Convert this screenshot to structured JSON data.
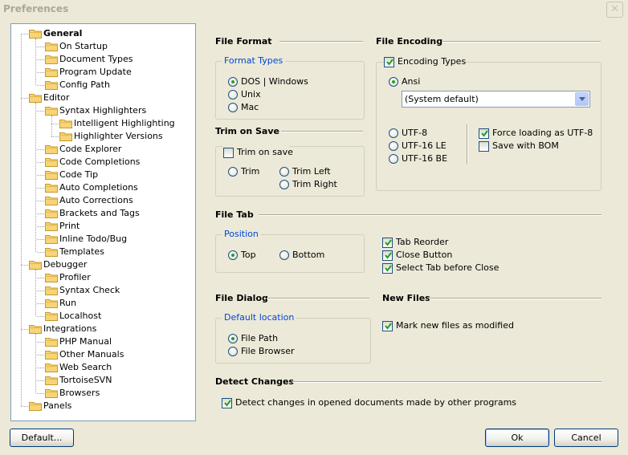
{
  "window": {
    "title": "Preferences",
    "close_glyph": "✕"
  },
  "tree": {
    "items": [
      {
        "label": "General",
        "bold": true,
        "level": 0
      },
      {
        "label": "On Startup",
        "level": 1
      },
      {
        "label": "Document Types",
        "level": 1
      },
      {
        "label": "Program Update",
        "level": 1
      },
      {
        "label": "Config Path",
        "level": 1
      },
      {
        "label": "Editor",
        "level": 0
      },
      {
        "label": "Syntax Highlighters",
        "level": 1
      },
      {
        "label": "Intelligent Highlighting",
        "level": 2
      },
      {
        "label": "Highlighter Versions",
        "level": 2
      },
      {
        "label": "Code Explorer",
        "level": 1
      },
      {
        "label": "Code Completions",
        "level": 1
      },
      {
        "label": "Code Tip",
        "level": 1
      },
      {
        "label": "Auto Completions",
        "level": 1
      },
      {
        "label": "Auto Corrections",
        "level": 1
      },
      {
        "label": "Brackets and Tags",
        "level": 1
      },
      {
        "label": "Print",
        "level": 1
      },
      {
        "label": "Inline Todo/Bug",
        "level": 1
      },
      {
        "label": "Templates",
        "level": 1
      },
      {
        "label": "Debugger",
        "level": 0
      },
      {
        "label": "Profiler",
        "level": 1
      },
      {
        "label": "Syntax Check",
        "level": 1
      },
      {
        "label": "Run",
        "level": 1
      },
      {
        "label": "Localhost",
        "level": 1
      },
      {
        "label": "Integrations",
        "level": 0
      },
      {
        "label": "PHP Manual",
        "level": 1
      },
      {
        "label": "Other Manuals",
        "level": 1
      },
      {
        "label": "Web Search",
        "level": 1
      },
      {
        "label": "TortoiseSVN",
        "level": 1
      },
      {
        "label": "Browsers",
        "level": 1
      },
      {
        "label": "Panels",
        "level": 0
      }
    ]
  },
  "file_format": {
    "title": "File Format",
    "group_label": "Format Types",
    "options": [
      {
        "label": "DOS | Windows",
        "selected": true
      },
      {
        "label": "Unix",
        "selected": false
      },
      {
        "label": "Mac",
        "selected": false
      }
    ]
  },
  "trim_on_save": {
    "title": "Trim on Save",
    "checkbox_label": "Trim on save",
    "checked": false,
    "options": [
      {
        "label": "Trim",
        "selected": false
      },
      {
        "label": "Trim Left",
        "selected": false
      },
      {
        "label": "Trim Right",
        "selected": false
      }
    ]
  },
  "file_encoding": {
    "title": "File Encoding",
    "encoding_types_label": "Encoding Types",
    "encoding_types_checked": true,
    "ansi_label": "Ansi",
    "ansi_selected": true,
    "ansi_select_value": "(System default)",
    "utf_options": [
      {
        "label": "UTF-8",
        "selected": false
      },
      {
        "label": "UTF-16 LE",
        "selected": false
      },
      {
        "label": "UTF-16 BE",
        "selected": false
      }
    ],
    "force_utf8_label": "Force loading as UTF-8",
    "force_utf8_checked": true,
    "save_bom_label": "Save with BOM",
    "save_bom_checked": false
  },
  "file_tab": {
    "title": "File Tab",
    "position_label": "Position",
    "positions": [
      {
        "label": "Top",
        "selected": true
      },
      {
        "label": "Bottom",
        "selected": false
      }
    ],
    "checks": [
      {
        "label": "Tab Reorder",
        "checked": true
      },
      {
        "label": "Close Button",
        "checked": true
      },
      {
        "label": "Select Tab before Close",
        "checked": true
      }
    ]
  },
  "file_dialog": {
    "title": "File Dialog",
    "group_label": "Default location",
    "options": [
      {
        "label": "File Path",
        "selected": true
      },
      {
        "label": "File Browser",
        "selected": false
      }
    ]
  },
  "new_files": {
    "title": "New Files",
    "mark_modified_label": "Mark new files as modified",
    "mark_modified_checked": true
  },
  "detect_changes": {
    "title": "Detect Changes",
    "checkbox_label": "Detect changes in opened documents made by other programs",
    "checked": true
  },
  "buttons": {
    "default": "Default...",
    "ok": "Ok",
    "cancel": "Cancel"
  },
  "colors": {
    "dialog_bg": "#ece9d8",
    "group_label": "#0046d5",
    "radio_dot": "#21a121",
    "check_mark": "#21a121",
    "button_border": "#003c74"
  }
}
